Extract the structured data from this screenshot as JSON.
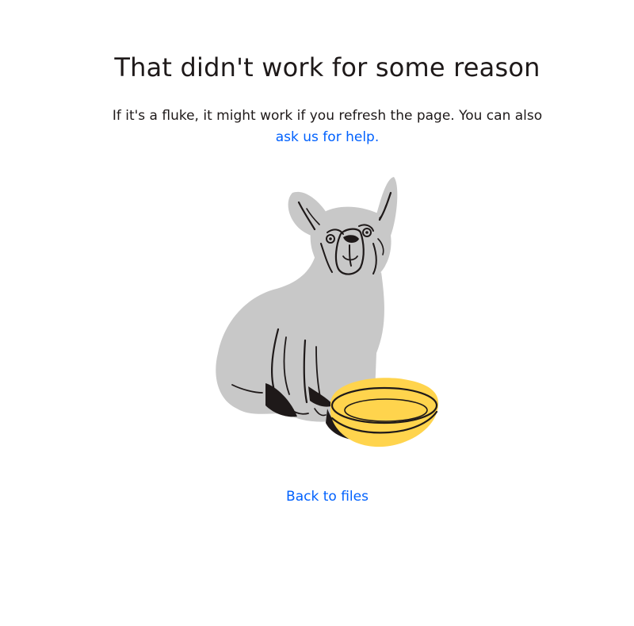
{
  "error": {
    "title": "That didn't work for some reason",
    "message_line1": "If it's a fluke, it might work if you refresh the page. You can also",
    "help_link_label": "ask us for help."
  },
  "illustration": {
    "icon": "sad-dog-with-empty-bowl-illustration",
    "colors": {
      "dog": "#c8c8c8",
      "bowl": "#ffd44d",
      "outline": "#1e1919"
    }
  },
  "navigation": {
    "back_label": "Back to files"
  },
  "colors": {
    "text": "#1e1919",
    "link": "#0061fe",
    "background": "#ffffff"
  }
}
